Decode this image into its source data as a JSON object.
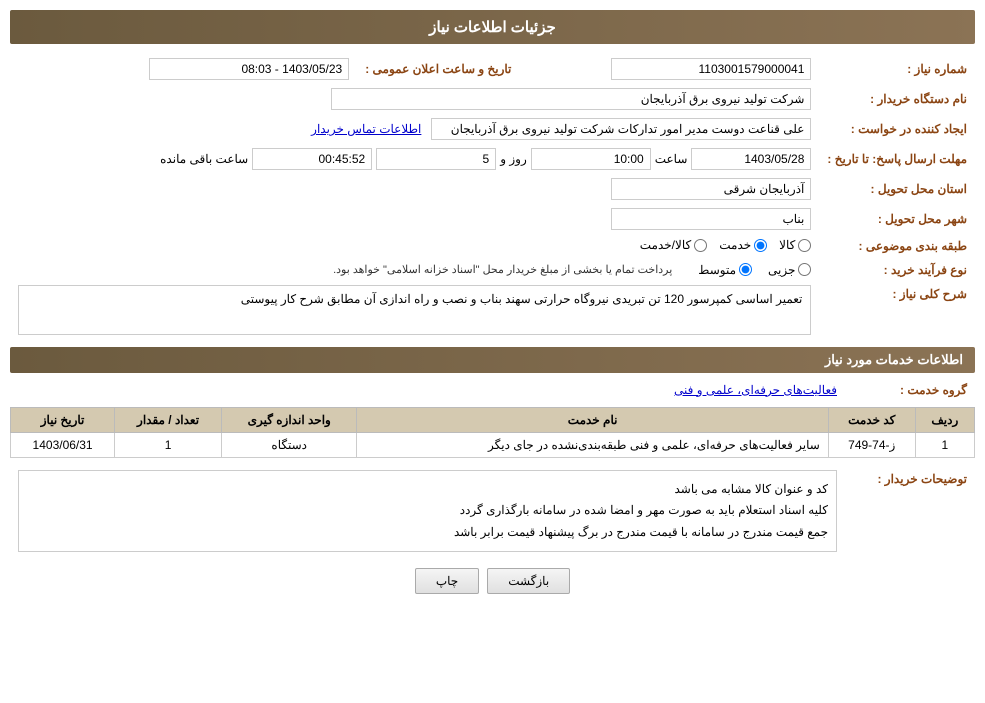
{
  "header": {
    "title": "جزئیات اطلاعات نیاز"
  },
  "fields": {
    "shomareNiaz_label": "شماره نیاز :",
    "shomareNiaz_value": "1103001579000041",
    "namDasgah_label": "نام دستگاه خریدار :",
    "namDasgah_value": "شرکت تولید نیروی برق آذربایجان",
    "ijadKonande_label": "ایجاد کننده در خواست :",
    "ijadKonande_value": "علی قناعت دوست مدیر امور تداركات شركت تولید نیروی برق آذربایجان",
    "ijadKonande_link": "اطلاعات تماس خریدار",
    "mohlat_label": "مهلت ارسال پاسخ: تا تاریخ :",
    "mohlat_date": "1403/05/28",
    "mohlat_saat_label": "ساعت",
    "mohlat_saat": "10:00",
    "mohlat_roz_label": "روز و",
    "mohlat_roz": "5",
    "mohlat_mande_label": "ساعت باقی مانده",
    "mohlat_mande": "00:45:52",
    "tarikh_label": "تاریخ و ساعت اعلان عمومی :",
    "tarikh_value": "1403/05/23 - 08:03",
    "ostan_label": "استان محل تحویل :",
    "ostan_value": "آذربایجان شرقی",
    "shahr_label": "شهر محل تحویل :",
    "shahr_value": "بناب",
    "tabaqe_label": "طبقه بندی موضوعی :",
    "tabaqe_kala": "کالا",
    "tabaqe_khadamat": "خدمت",
    "tabaqe_kala_khadamat": "کالا/خدمت",
    "noeFarayand_label": "نوع فرآیند خرید :",
    "noeFarayand_jozii": "جزیی",
    "noeFarayand_motevaset": "متوسط",
    "noeFarayand_note": "پرداخت تمام یا بخشی از مبلغ خریدار محل \"اسناد خزانه اسلامی\" خواهد بود.",
    "sharh_label": "شرح کلی نیاز :",
    "sharh_value": "تعمیر اساسی کمپرسور 120 تن تبریدی نیروگاه حرارتی سهند بناب و نصب و راه اندازی آن مطابق شرح کار پیوستی",
    "khadamat_label": "اطلاعات خدمات مورد نیاز",
    "grohe_label": "گروه خدمت :",
    "grohe_value": "فعالیت‌های حرفه‌ای، علمی و فنی",
    "table": {
      "headers": [
        "ردیف",
        "کد خدمت",
        "نام خدمت",
        "واحد اندازه گیری",
        "تعداد / مقدار",
        "تاریخ نیاز"
      ],
      "rows": [
        {
          "radif": "1",
          "kod": "ز-74-749",
          "name": "سایر فعالیت‌های حرفه‌ای، علمی و فنی طبقه‌بندی‌نشده در جای دیگر",
          "vahed": "دستگاه",
          "tedad": "1",
          "tarikh": "1403/06/31"
        }
      ]
    },
    "buyer_notes_label": "توضیحات خریدار :",
    "buyer_notes_line1": "کد و عنوان کالا مشابه می باشد",
    "buyer_notes_line2": "کلیه اسناد استعلام باید به صورت مهر و امضا شده در سامانه بارگذاری گردد",
    "buyer_notes_line3": "جمع قیمت مندرج در سامانه با قیمت مندرج در برگ پیشنهاد قیمت برابر باشد"
  },
  "buttons": {
    "chap": "چاپ",
    "bazgasht": "بازگشت"
  }
}
